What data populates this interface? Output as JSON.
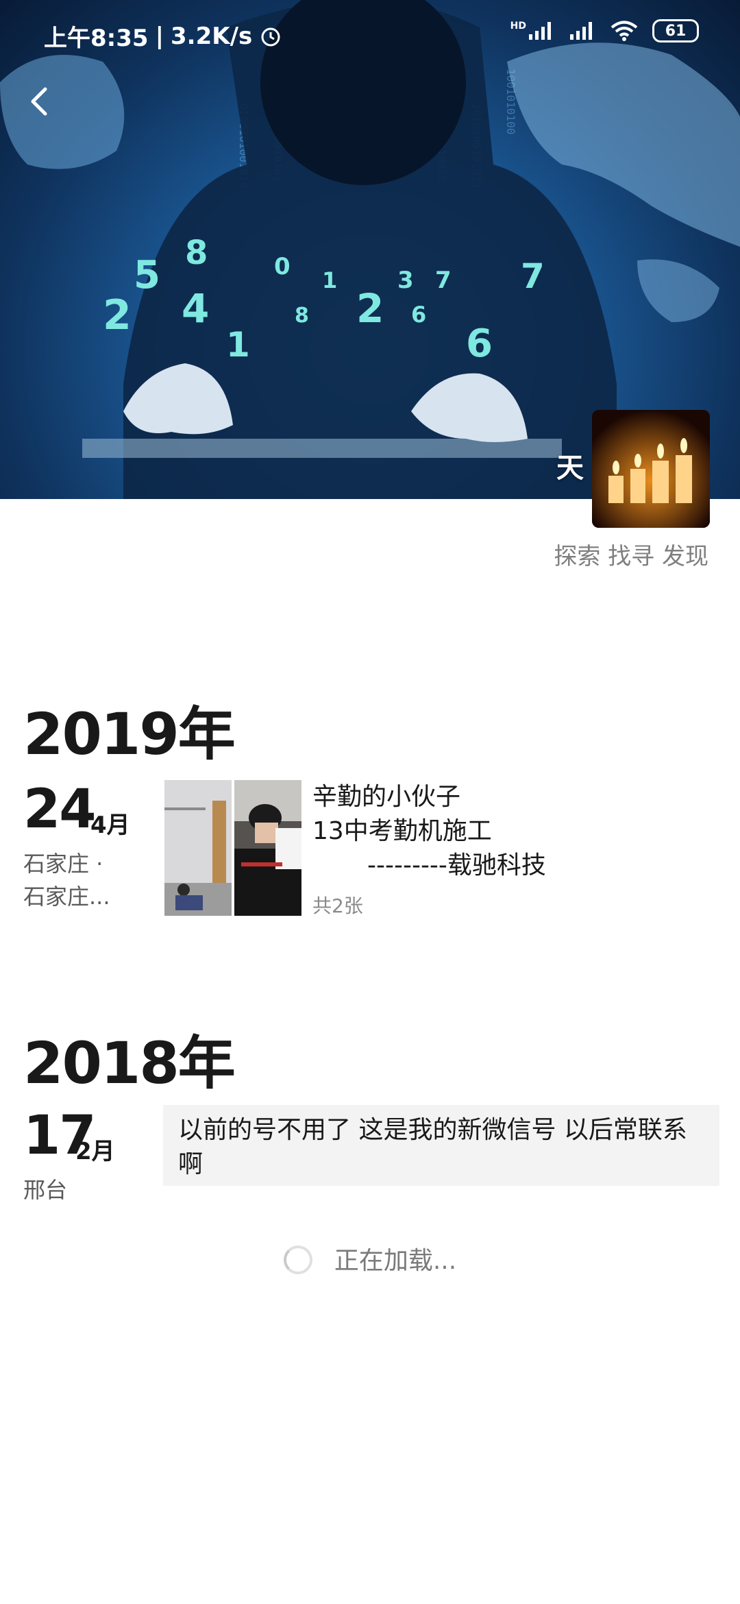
{
  "status_bar": {
    "time": "上午8:35",
    "net_speed": "3.2K/s",
    "hd_label": "HD",
    "battery": "61"
  },
  "header": {
    "back_icon": "chevron-left-icon",
    "nickname": "天",
    "signature": "探索 找寻 发现",
    "avatar_alt": "candles"
  },
  "timeline": [
    {
      "year": "2019年",
      "day": "24",
      "month": "4月",
      "location_line1": "石家庄 ·",
      "location_line2": "石家庄...",
      "text_lines": [
        "辛勤的小伙子",
        "13中考勤机施工",
        "---------载驰科技"
      ],
      "photo_count": "共2张"
    },
    {
      "year": "2018年",
      "day": "17",
      "month": "2月",
      "location_line1": "邢台",
      "text": "以前的号不用了 这是我的新微信号 以后常联系啊"
    }
  ],
  "loading_text": "正在加载..."
}
